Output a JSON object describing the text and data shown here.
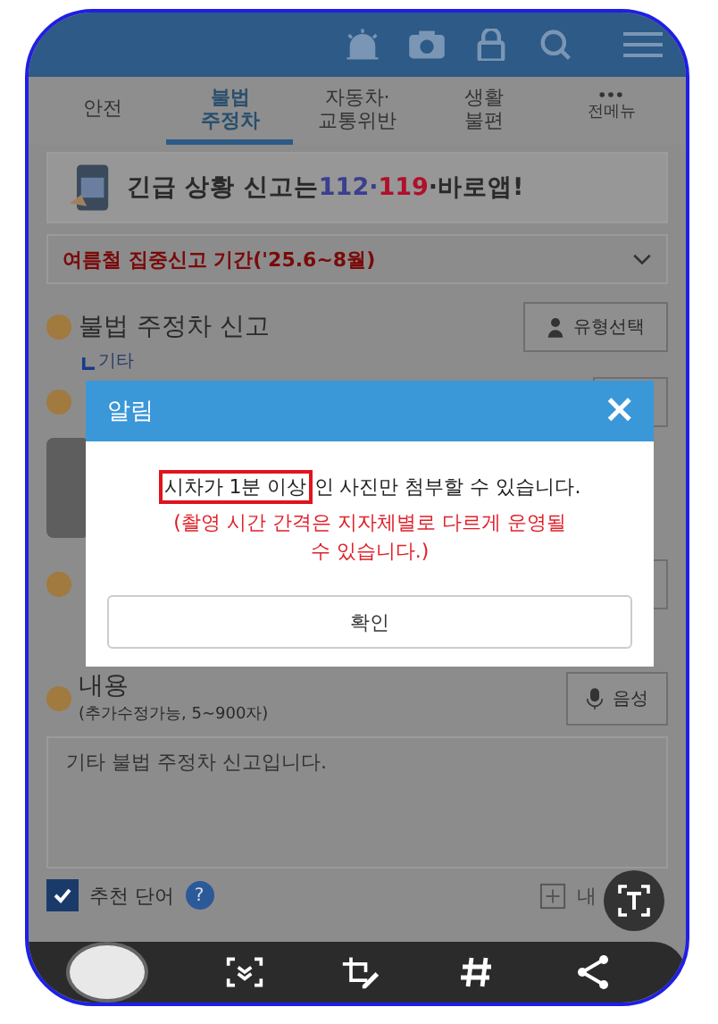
{
  "tabs": [
    {
      "label": "안전",
      "selected": false
    },
    {
      "label": "불법\n주정차",
      "selected": true
    },
    {
      "label": "자동차·\n교통위반",
      "selected": false
    },
    {
      "label": "생활\n불편",
      "selected": false
    },
    {
      "label": "전메뉴",
      "selected": false
    }
  ],
  "banner": {
    "parts": [
      {
        "text": "긴급 상황 신고는",
        "color": "#2a2a2a"
      },
      {
        "text": "112",
        "color": "#3a3f8f"
      },
      {
        "text": "·",
        "color": "#3a3f8f"
      },
      {
        "text": "119",
        "color": "#b0102a"
      },
      {
        "text": "·바로앱!",
        "color": "#2a2a2a"
      }
    ]
  },
  "period_dropdown": {
    "value": "여름철 집중신고 기간('25.6~8월)"
  },
  "report": {
    "title": "불법 주정차 신고",
    "type_button": "유형선택",
    "type": "기타"
  },
  "content": {
    "title": "내용",
    "hint": "(추가수정가능, 5~900자)",
    "voice_button": "음성",
    "value": "기타 불법 주정차 신고입니다."
  },
  "recommend": {
    "label": "추천 단어",
    "checked": true,
    "help": "?",
    "right_label": "내"
  },
  "dialog": {
    "title": "알림",
    "close": "×",
    "highlight": "시차가 1분 이상",
    "message": "인 사진만 첨부할 수 있습니다.",
    "note": "(촬영 시간 간격은 지자체별로 다르게 운영될 수 있습니다.)",
    "button": "확인"
  }
}
